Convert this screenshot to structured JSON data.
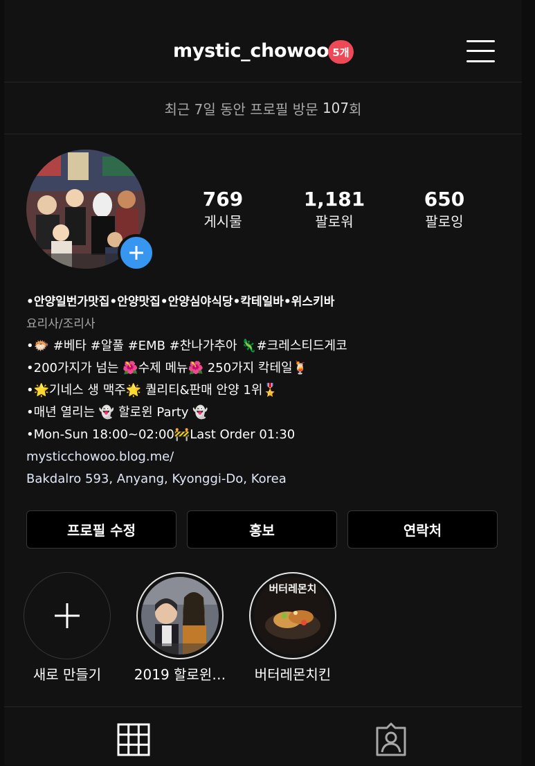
{
  "header": {
    "username": "mystic_chowoo",
    "notification_badge": "5개",
    "menu_icon": "hamburger-menu-icon"
  },
  "visits": {
    "prefix": "최근 7일 동안 프로필 방문 ",
    "count": "107",
    "suffix": "회"
  },
  "profile": {
    "add_story_icon": "plus-icon",
    "stats": [
      {
        "value": "769",
        "label": "게시물"
      },
      {
        "value": "1,181",
        "label": "팔로워"
      },
      {
        "value": "650",
        "label": "팔로잉"
      }
    ]
  },
  "bio": {
    "name": "•안양일번가맛집•안양맛집•안양심야식당•칵테일바•위스키바",
    "category": "요리사/조리사",
    "lines": [
      "•🐡 #베타 #알풀 #EMB #찬나가추아 🦎#크레스티드게코",
      "•200가지가 넘는 🌺수제 메뉴🌺 250가지 칵테일🍹",
      "•🌟기네스 생 맥주🌟 퀄리티&판매 안양 1위🎖️",
      "•매년 열리는 👻 할로윈 Party 👻",
      "•Mon-Sun 18:00~02:00🚧Last Order 01:30"
    ],
    "link": "mysticchowoo.blog.me/",
    "address": "Bakdalro 593, Anyang, Kyonggi-Do, Korea"
  },
  "buttons": {
    "edit_profile": "프로필 수정",
    "promote": "홍보",
    "contact": "연락처"
  },
  "highlights": [
    {
      "label": "새로 만들기",
      "cover_text": ""
    },
    {
      "label": "2019 할로윈…",
      "cover_text": ""
    },
    {
      "label": "버터레몬치킨",
      "cover_text": "버터레몬치"
    }
  ],
  "tabs": {
    "grid_icon": "grid-icon",
    "tagged_icon": "tagged-person-icon"
  },
  "colors": {
    "background": "#121212",
    "badge": "#ed4956",
    "accent_blue": "#3797f0",
    "button_bg": "#000000",
    "muted_text": "#a8a8a8"
  }
}
